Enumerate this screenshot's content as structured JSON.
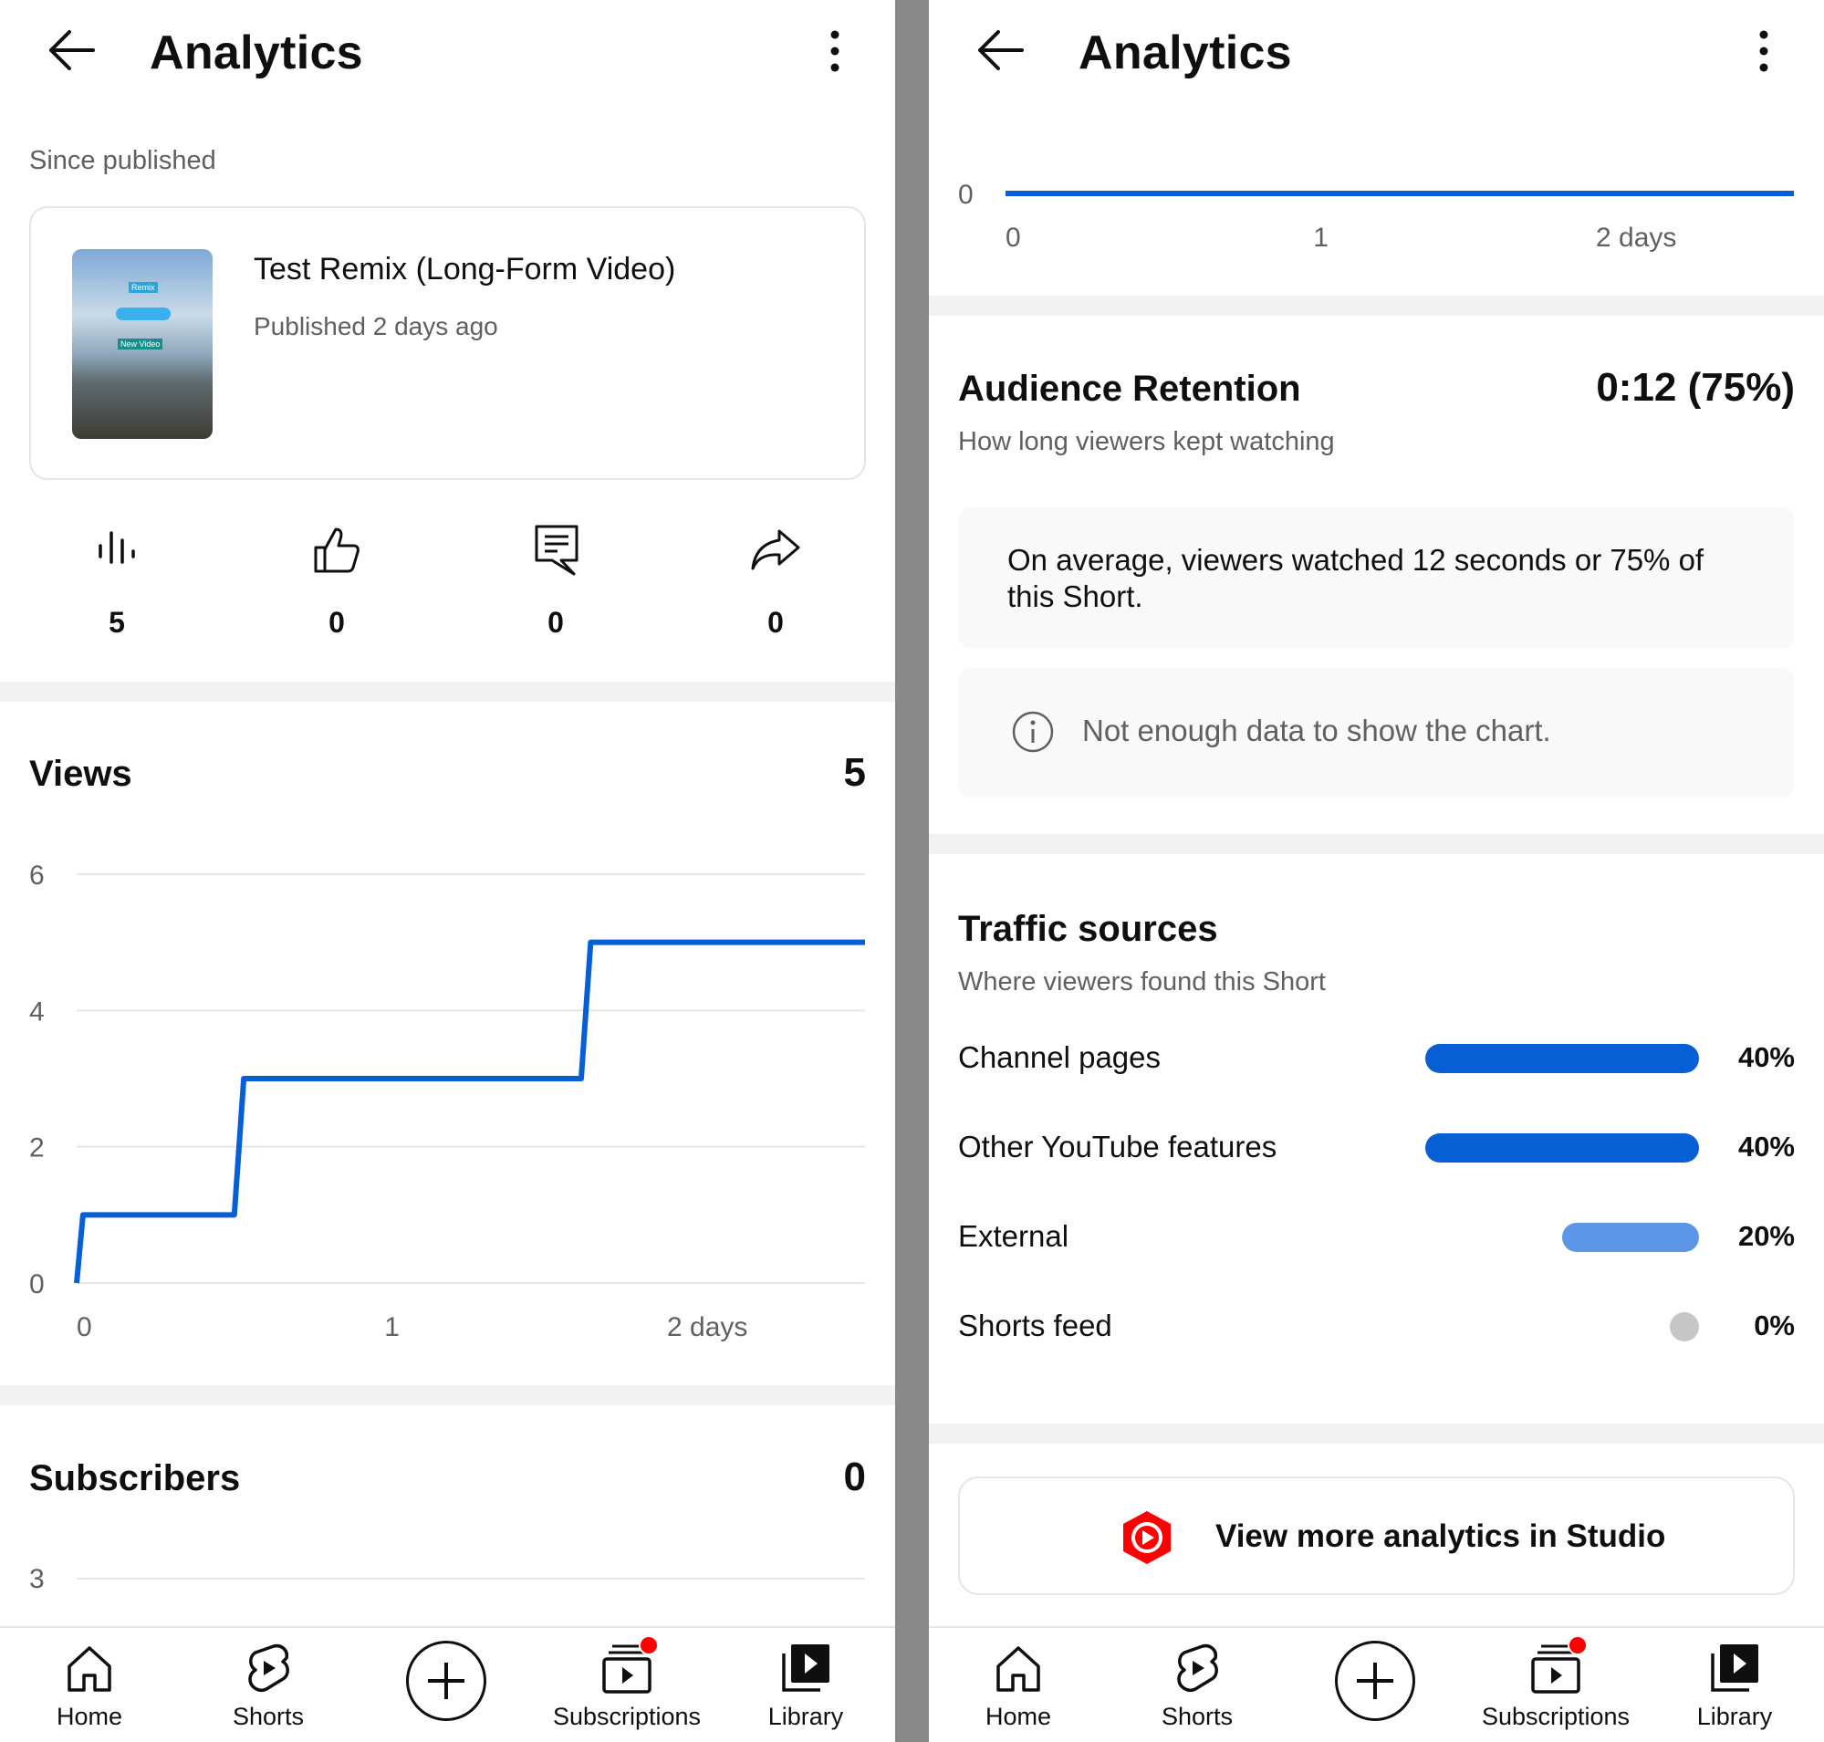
{
  "left": {
    "header": {
      "title": "Analytics"
    },
    "since_label": "Since published",
    "video": {
      "title": "Test Remix (Long-Form Video)",
      "published": "Published 2 days ago",
      "thumb_text_1": "Remix",
      "thumb_text_2": "New Video"
    },
    "stats": {
      "views": "5",
      "likes": "0",
      "comments": "0",
      "shares": "0"
    },
    "views": {
      "title": "Views",
      "value": "5"
    },
    "subscribers": {
      "title": "Subscribers",
      "value": "0",
      "axis_top": "3"
    }
  },
  "right": {
    "header": {
      "title": "Analytics"
    },
    "top_chart": {
      "y_label": "0",
      "x_labels": [
        "0",
        "1",
        "2 days"
      ]
    },
    "retention": {
      "title": "Audience Retention",
      "value": "0:12 (75%)",
      "subtitle": "How long viewers kept watching",
      "summary": "On average, viewers watched 12 seconds or 75% of this Short.",
      "no_data": "Not enough data to show the chart."
    },
    "traffic": {
      "title": "Traffic sources",
      "subtitle": "Where viewers found this Short",
      "items": [
        {
          "label": "Channel pages",
          "pct": "40%",
          "value": 40
        },
        {
          "label": "Other YouTube features",
          "pct": "40%",
          "value": 40
        },
        {
          "label": "External",
          "pct": "20%",
          "value": 20
        },
        {
          "label": "Shorts feed",
          "pct": "0%",
          "value": 0
        }
      ]
    },
    "studio_button": "View more analytics in Studio"
  },
  "nav": {
    "home": "Home",
    "shorts": "Shorts",
    "subscriptions": "Subscriptions",
    "library": "Library"
  },
  "colors": {
    "primary_blue": "#065fd4",
    "light_blue": "#5d96e6",
    "red": "#ff0000",
    "grey_dot": "#c6c6c6"
  },
  "chart_data": [
    {
      "type": "line",
      "title": "Views",
      "x_ticks": [
        "0",
        "1",
        "2 days"
      ],
      "y_ticks": [
        0,
        2,
        4,
        6
      ],
      "ylim": [
        0,
        6
      ],
      "xlim": [
        0,
        2.5
      ],
      "series": [
        {
          "x": [
            0,
            0.02,
            0.5,
            0.53,
            1.6,
            1.63,
            2.5
          ],
          "y": [
            0,
            1,
            1,
            3,
            3,
            5,
            5
          ]
        }
      ]
    },
    {
      "type": "line",
      "x_ticks": [
        "0",
        "1",
        "2 days"
      ],
      "y_ticks": [
        0
      ],
      "xlim": [
        0,
        2.5
      ],
      "series": [
        {
          "x": [
            0,
            2.5
          ],
          "y": [
            0,
            0
          ]
        }
      ]
    }
  ]
}
